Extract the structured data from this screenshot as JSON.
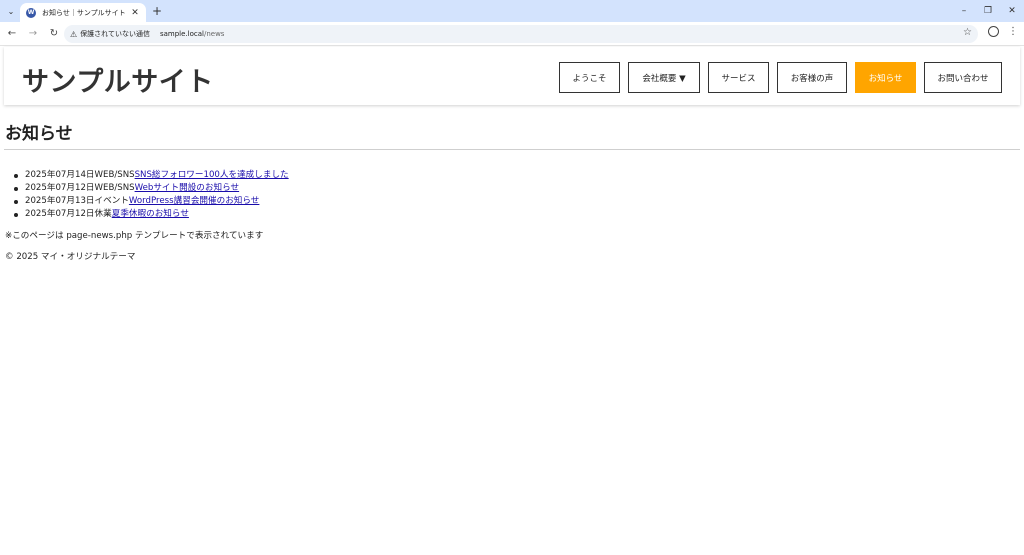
{
  "browser": {
    "tab_title": "お知らせ｜サンプルサイト",
    "tab_close": "✕",
    "new_tab": "+",
    "security_label": "保護されていない通信",
    "url_host": "sample.local",
    "url_path": "/news",
    "icons": [
      "tab-scroll-icon",
      "wordpress-icon",
      "back-icon",
      "forward-icon",
      "reload-icon",
      "warning-icon",
      "star-icon",
      "profile-icon",
      "menu-icon"
    ]
  },
  "site": {
    "title": "サンプルサイト",
    "nav": [
      {
        "label": "ようこそ",
        "active": false
      },
      {
        "label": "会社概要 ▼",
        "active": false
      },
      {
        "label": "サービス",
        "active": false
      },
      {
        "label": "お客様の声",
        "active": false
      },
      {
        "label": "お知らせ",
        "active": true
      },
      {
        "label": "お問い合わせ",
        "active": false
      }
    ],
    "accent_color": "#ffa500"
  },
  "main": {
    "page_title": "お知らせ",
    "news": [
      {
        "date": "2025年07月14日",
        "category": "WEB/SNS",
        "title": "SNS総フォロワー100人を達成しました"
      },
      {
        "date": "2025年07月12日",
        "category": "WEB/SNS",
        "title": "Webサイト開設のお知らせ"
      },
      {
        "date": "2025年07月13日",
        "category": "イベント",
        "title": "WordPress講習会開催のお知らせ"
      },
      {
        "date": "2025年07月12日",
        "category": "休業",
        "title": "夏季休暇のお知らせ"
      }
    ],
    "note": "※このページは page-news.php テンプレートで表示されています"
  },
  "footer": {
    "copyright": "© 2025 マイ・オリジナルテーマ"
  }
}
